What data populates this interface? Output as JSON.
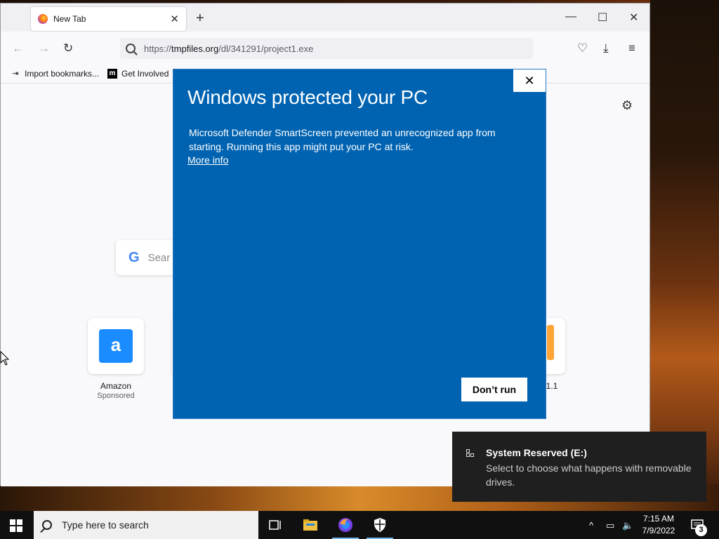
{
  "browser": {
    "tab": {
      "title": "New Tab"
    },
    "url": {
      "prefix": "https://",
      "host": "tmpfiles.org",
      "path": "/dl/341291/project1.exe"
    },
    "bookmarks": [
      {
        "label": "Import bookmarks...",
        "icon": "import-icon"
      },
      {
        "label": "Get Involved",
        "icon": "mozilla-m-icon"
      }
    ],
    "newtab": {
      "search_placeholder": "Sear",
      "shortcuts": [
        {
          "title": "Amazon",
          "subtitle": "Sponsored",
          "icon": "amazon-icon"
        },
        {
          "title": "1.1",
          "subtitle": ""
        }
      ]
    }
  },
  "dialog": {
    "title": "Windows protected your PC",
    "body": "Microsoft Defender SmartScreen prevented an unrecognized app from starting. Running this app might put your PC at risk.",
    "more_info": "More info",
    "dont_run": "Don’t run",
    "background_color": "#0063b1"
  },
  "toast": {
    "title": "System Reserved (E:)",
    "body": "Select to choose what happens with removable drives."
  },
  "taskbar": {
    "search_placeholder": "Type here to search",
    "time": "7:15 AM",
    "date": "7/9/2022",
    "notification_count": "3"
  }
}
